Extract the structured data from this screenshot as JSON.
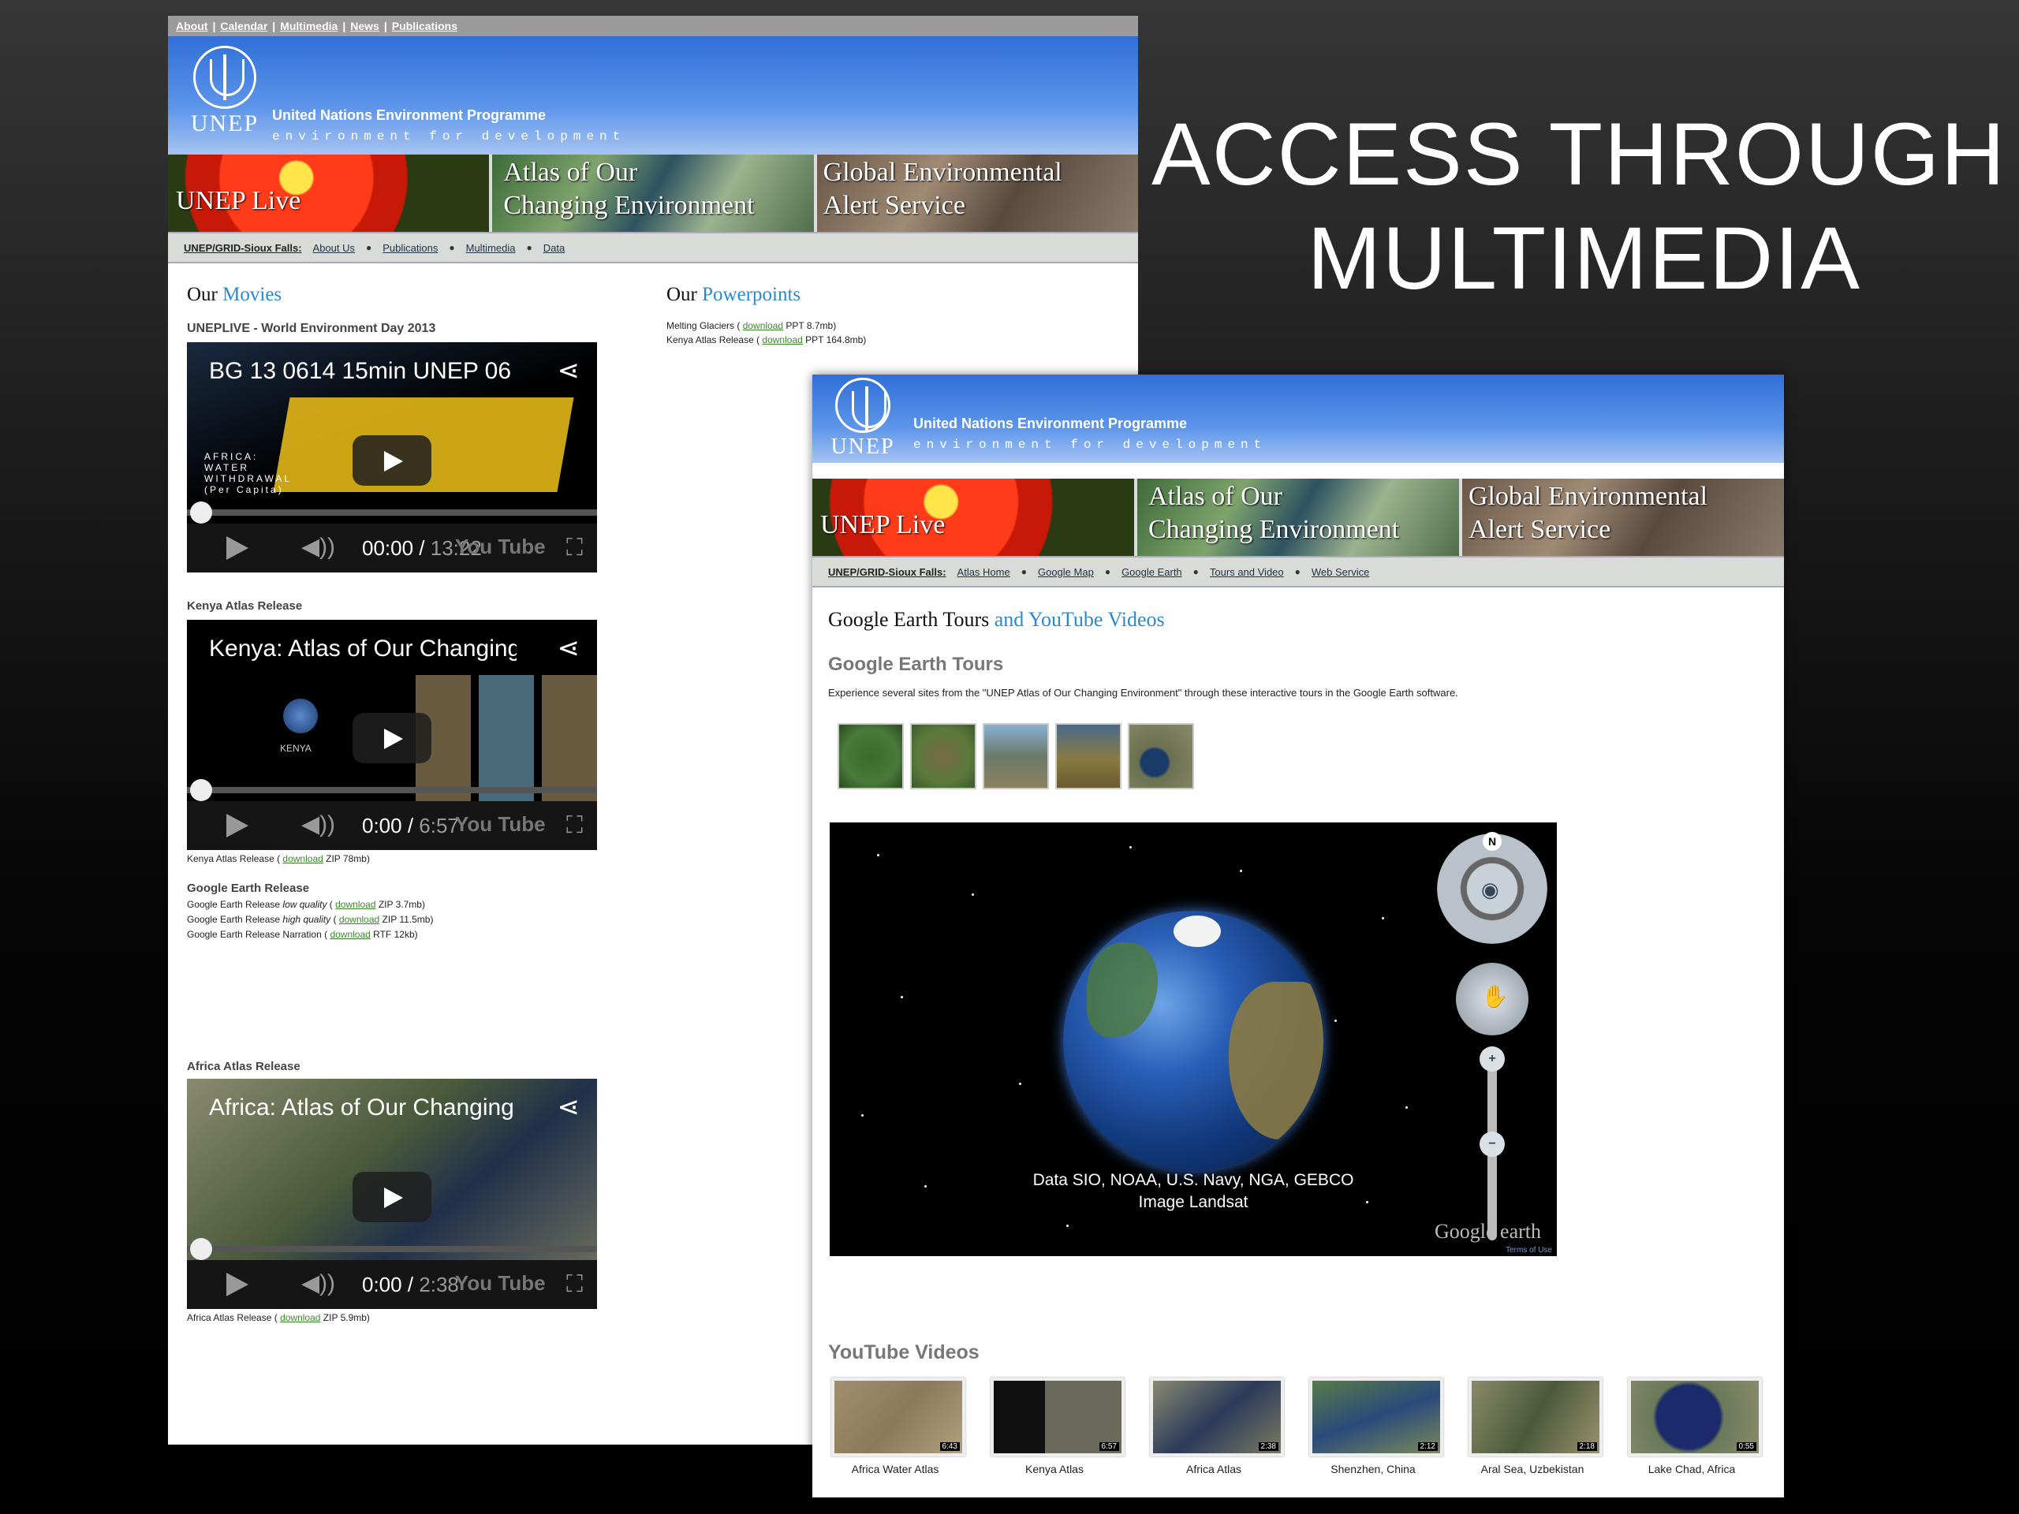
{
  "slide": {
    "title_line1": "ACCESS THROUGH",
    "title_line2": "MULTIMEDIA"
  },
  "colors": {
    "header_blue": "#2f6fd8",
    "link_blue": "#2a8ad0",
    "download_green": "#3a8a2a"
  },
  "page1": {
    "topnav": [
      "About",
      "Calendar",
      "Multimedia",
      "News",
      "Publications"
    ],
    "header": {
      "logo": "UNEP",
      "title": "United Nations Environment Programme",
      "subtitle": "environment for development"
    },
    "banners": {
      "live": "UNEP Live",
      "atlas_line1": "Atlas of Our",
      "atlas_line2": "Changing Environment",
      "geas_line1": "Global Environmental",
      "geas_line2": "Alert Service"
    },
    "subnav": {
      "home": "UNEP/GRID-Sioux Falls:",
      "items": [
        "About Us",
        "Publications",
        "Multimedia",
        "Data"
      ]
    },
    "movies_heading": {
      "prefix": "Our",
      "highlight": "Movies"
    },
    "powerpoints_heading": {
      "prefix": "Our",
      "highlight": "Powerpoints"
    },
    "powerpoints": [
      {
        "name": "Melting Glaciers",
        "link": "download",
        "info": "PPT 8.7mb)"
      },
      {
        "name": "Kenya Atlas Release",
        "link": "download",
        "info": "PPT 164.8mb)"
      }
    ],
    "section1": "UNEPLIVE - World Environment Day 2013",
    "video1": {
      "title": "BG 13 0614 15min UNEP 06",
      "overlay": "AFRICA: WATER WITHDRAWAL (Per Capita)",
      "time_current": "00:00",
      "time_total": "13:22",
      "yt": "You Tube"
    },
    "section2": "Kenya Atlas Release",
    "video2": {
      "title": "Kenya: Atlas of Our Changing",
      "overlay": "KENYA",
      "time_current": "0:00",
      "time_total": "6:57",
      "yt": "You Tube"
    },
    "kenya_dl": {
      "name": "Kenya Atlas Release",
      "link": "download",
      "info": "ZIP 78mb)"
    },
    "section3": "Google Earth Release",
    "ge_releases": [
      {
        "name": "Google Earth Release",
        "note": "low quality",
        "link": "download",
        "info": "ZIP 3.7mb)"
      },
      {
        "name": "Google Earth Release",
        "note": "high quality",
        "link": "download",
        "info": "ZIP 11.5mb)"
      },
      {
        "name": "Google Earth Release Narration",
        "note": "",
        "link": "download",
        "info": "RTF 12kb)"
      }
    ],
    "section4": "Africa Atlas Release",
    "video3": {
      "title": "Africa: Atlas of Our Changing",
      "time_current": "0:00",
      "time_total": "2:38",
      "yt": "You Tube"
    },
    "africa_dl": {
      "name": "Africa Atlas Release",
      "link": "download",
      "info": "ZIP 5.9mb)"
    }
  },
  "page2": {
    "header": {
      "logo": "UNEP",
      "title": "United Nations Environment Programme",
      "subtitle": "environment for development"
    },
    "banners": {
      "live": "UNEP Live",
      "atlas_line1": "Atlas of Our",
      "atlas_line2": "Changing Environment",
      "geas_line1": "Global Environmental",
      "geas_line2": "Alert Service"
    },
    "subnav": {
      "home": "UNEP/GRID-Sioux Falls:",
      "items": [
        "Atlas Home",
        "Google Map",
        "Google Earth",
        "Tours and Video",
        "Web Service"
      ]
    },
    "heading": {
      "prefix": "Google Earth Tours",
      "highlight": "and YouTube Videos"
    },
    "tours_heading": "Google Earth Tours",
    "tours_desc": "Experience several sites from the \"UNEP Atlas of Our Changing Environment\" through these interactive tours in the Google Earth software.",
    "ge_viewer": {
      "attribution_line1": "Data SIO, NOAA, U.S. Navy, NGA, GEBCO",
      "attribution_line2": "Image Landsat",
      "logo": "Google earth",
      "compass": "N",
      "terms": "Terms of Use"
    },
    "youtube_heading": "YouTube Videos",
    "youtube_videos": [
      {
        "caption": "Africa Water Atlas",
        "duration": "6:43"
      },
      {
        "caption": "Kenya Atlas",
        "duration": "6:57"
      },
      {
        "caption": "Africa Atlas",
        "duration": "2:38"
      },
      {
        "caption": "Shenzhen, China",
        "duration": "2:12"
      },
      {
        "caption": "Aral Sea, Uzbekistan",
        "duration": "2:18"
      },
      {
        "caption": "Lake Chad, Africa",
        "duration": "0:55"
      }
    ]
  }
}
